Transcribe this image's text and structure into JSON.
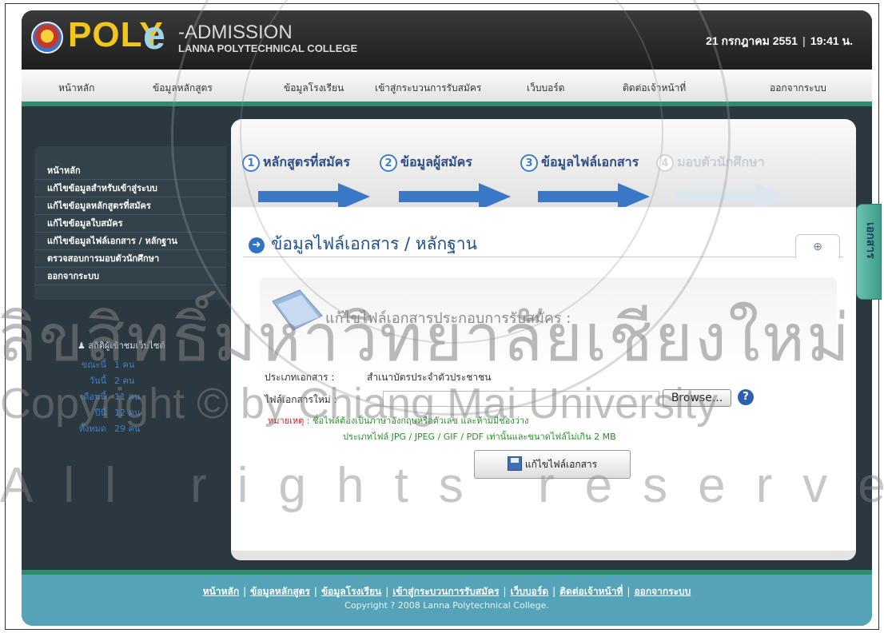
{
  "header": {
    "logo_poly": "POLY",
    "logo_e": "e",
    "logo_admission": "-ADMISSION",
    "logo_college": "LANNA POLYTECHNICAL COLLEGE",
    "date": "21 กรกฎาคม 2551",
    "time": "19:41 น."
  },
  "nav": {
    "items": [
      "หน้าหลัก",
      "ข้อมูลหลักสูตร",
      "ข้อมูลโรงเรียน",
      "เข้าสู่กระบวนการรับสมัคร",
      "เว็บบอร์ด",
      "ติดต่อเจ้าหน้าที่",
      "ออกจากระบบ"
    ]
  },
  "sidebar": {
    "items": [
      "หน้าหลัก",
      "แก้ไขข้อมูลสำหรับเข้าสู่ระบบ",
      "แก้ไขข้อมูลหลักสูตรที่สมัคร",
      "แก้ไขข้อมูลใบสมัคร",
      "แก้ไขข้อมูลไฟล์เอกสาร / หลักฐาน",
      "ตรวจสอบการมอบตัวนักศึกษา",
      "ออกจากระบบ"
    ],
    "stats_title": "สถิติผู้เข้าชมเว็บไซต์",
    "stats": [
      {
        "label": "ขณะนี้",
        "value": "1 คน"
      },
      {
        "label": "วันนี้",
        "value": "2 คน"
      },
      {
        "label": "เดือนนี้",
        "value": "11 คน"
      },
      {
        "label": "ปีนี้",
        "value": "12 คน"
      },
      {
        "label": "ทั้งหมด",
        "value": "29 คน"
      }
    ]
  },
  "steps": [
    {
      "num": "1",
      "label": "หลักสูตรที่สมัคร"
    },
    {
      "num": "2",
      "label": "ข้อมูลผู้สมัคร"
    },
    {
      "num": "3",
      "label": "ข้อมูลไฟล์เอกสาร"
    },
    {
      "num": "4",
      "label": "มอบตัวนักศึกษา"
    }
  ],
  "main": {
    "title": "ข้อมูลไฟล์เอกสาร / หลักฐาน",
    "form_heading": "แก้ไขไฟล์เอกสารประกอบการรับสมัคร :",
    "doc_type_label": "ประเภทเอกสาร :",
    "doc_type_value": "สำเนาบัตรประจำตัวประชาชน",
    "new_file_label": "ไฟล์เอกสารใหม่ :",
    "file_value": "",
    "browse_label": "Browse...",
    "note_prefix": "หมายเหตุ :",
    "note_line1": "ชื่อไฟล์ต้องเป็นภาษาอังกฤษหรือตัวเลข และห้ามมีช่องว่าง",
    "note_line2": "ประเภทไฟล์ JPG / JPEG / GIF / PDF เท่านั้นและขนาดไฟล์ไม่เกิน 2 MB",
    "submit_label": "แก้ไขไฟล์เอกสาร"
  },
  "side_tab": "เอกสาร",
  "footer": {
    "links": [
      "หน้าหลัก",
      "ข้อมูลหลักสูตร",
      "ข้อมูลโรงเรียน",
      "เข้าสู่กระบวนการรับสมัคร",
      "เว็บบอร์ด",
      "ติดต่อเจ้าหน้าที่",
      "ออกจากระบบ"
    ],
    "copyright": "Copyright ? 2008 Lanna Polytechnical College."
  },
  "watermark": {
    "thai": "ลิขสิทธิ์มหาวิทยาลัยเชียงใหม่",
    "copyright": "Copyright © by Chiang Mai University",
    "rights": "All rights reserved"
  }
}
